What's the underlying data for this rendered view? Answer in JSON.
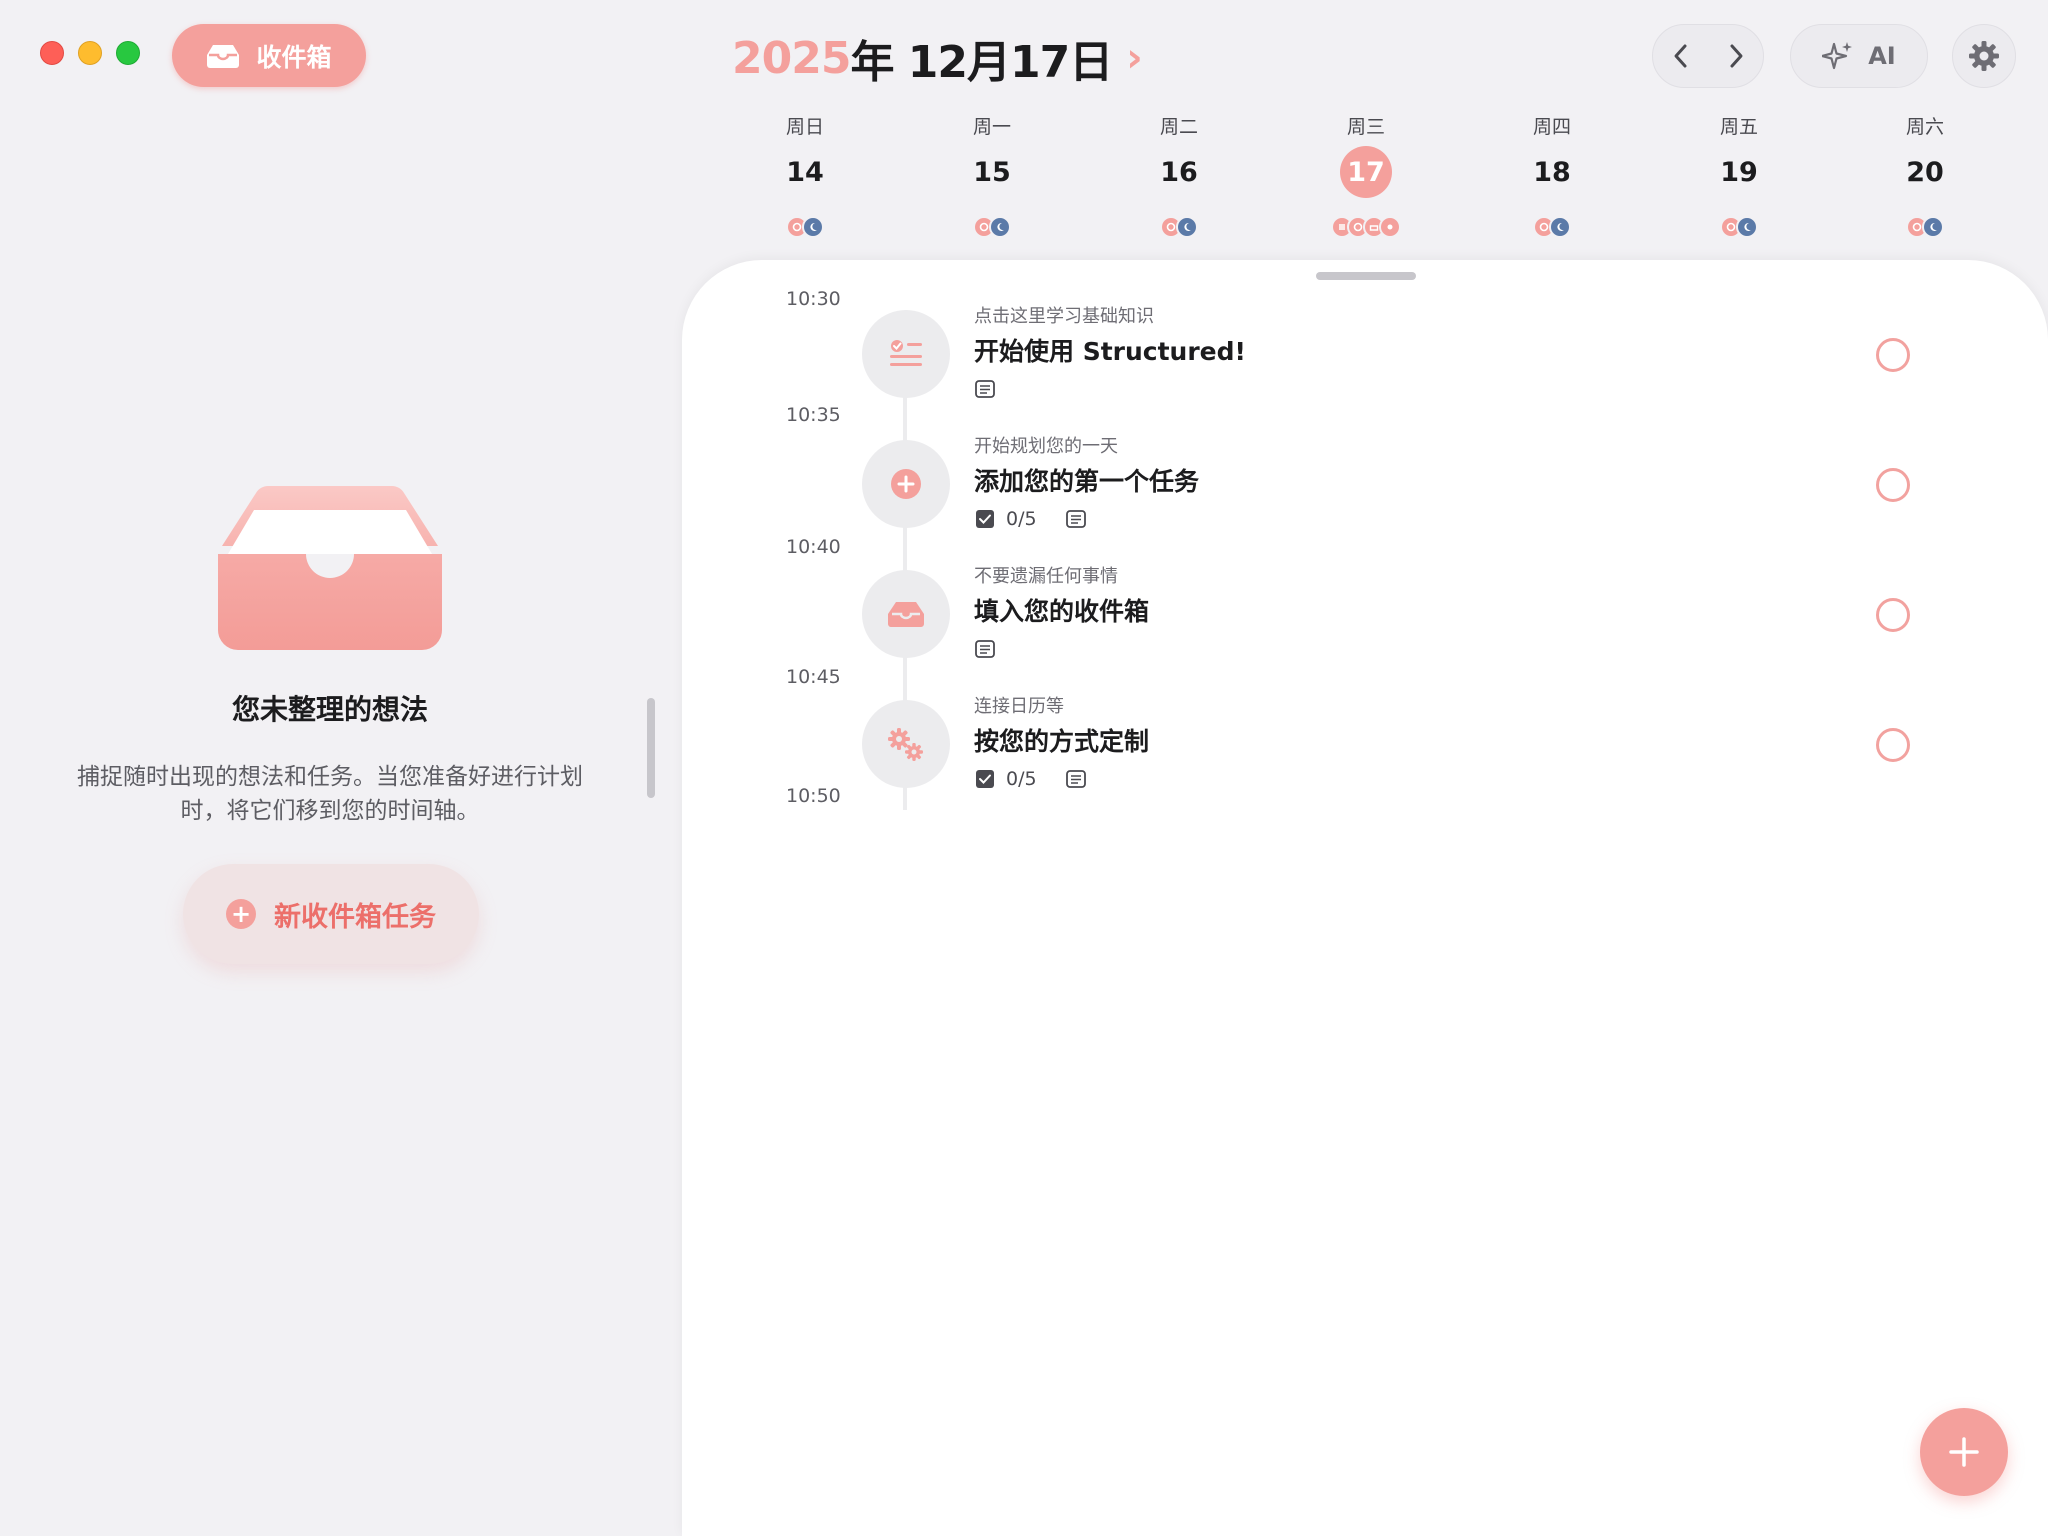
{
  "inbox_button": {
    "label": "收件箱"
  },
  "header": {
    "year": "2025",
    "month_day": "年 12月17日",
    "chevron": "›",
    "ai_label": "AI"
  },
  "week": [
    {
      "name": "周日",
      "num": "14",
      "selected": false
    },
    {
      "name": "周一",
      "num": "15",
      "selected": false
    },
    {
      "name": "周二",
      "num": "16",
      "selected": false
    },
    {
      "name": "周三",
      "num": "17",
      "selected": true
    },
    {
      "name": "周四",
      "num": "18",
      "selected": false
    },
    {
      "name": "周五",
      "num": "19",
      "selected": false
    },
    {
      "name": "周六",
      "num": "20",
      "selected": false
    }
  ],
  "inbox_panel": {
    "title": "您未整理的想法",
    "description": "捕捉随时出现的想法和任务。当您准备好进行计划时，将它们移到您的时间轴。",
    "new_button": "新收件箱任务"
  },
  "timeline": {
    "times": [
      "10:30",
      "10:35",
      "10:40",
      "10:45",
      "10:50"
    ],
    "tasks": [
      {
        "subtitle": "点击这里学习基础知识",
        "title": "开始使用 Structured!",
        "subtasks": "",
        "icon": "checklist-icon"
      },
      {
        "subtitle": "开始规划您的一天",
        "title": "添加您的第一个任务",
        "subtasks": "0/5",
        "icon": "plus-circle-icon"
      },
      {
        "subtitle": "不要遗漏任何事情",
        "title": "填入您的收件箱",
        "subtasks": "",
        "icon": "inbox-tray-icon"
      },
      {
        "subtitle": "连接日历等",
        "title": "按您的方式定制",
        "subtasks": "0/5",
        "icon": "gears-icon"
      }
    ]
  },
  "colors": {
    "accent": "#f4a09c",
    "accent_text": "#ec6f6a",
    "night_blue": "#5b7aa8",
    "background": "#f2f1f4",
    "panel": "#ffffff"
  }
}
